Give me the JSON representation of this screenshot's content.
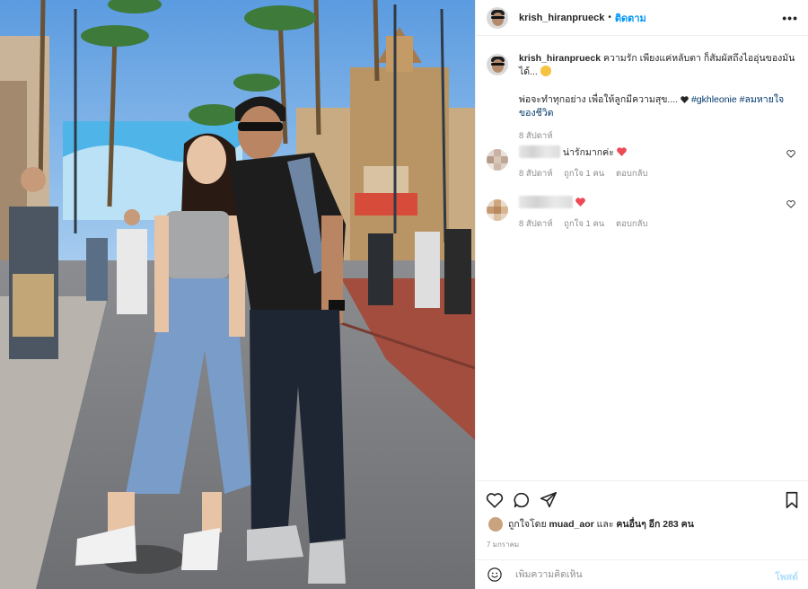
{
  "header": {
    "username": "krish_hiranprueck",
    "separator": "•",
    "follow_label": "ติดตาม",
    "more_icon": "more-horizontal-icon"
  },
  "caption": {
    "username": "krish_hiranprueck",
    "line1": "ความรัก เพียงแค่หลับตา ก็สัมผัสถึงไออุ่นของมันได้...",
    "line2": "พ่อจะทำทุกอย่าง เพื่อให้ลูกมีความสุข....",
    "hashtag1": "#gkhleonie",
    "hashtag2": "#ลมหายใจของชีวิต",
    "time": "8 สัปดาห์"
  },
  "comments": [
    {
      "text": "น่ารักมากค่ะ",
      "time": "8 สัปดาห์",
      "likes": "ถูกใจ 1 คน",
      "reply": "ตอบกลับ"
    },
    {
      "text": "",
      "time": "8 สัปดาห์",
      "likes": "ถูกใจ 1 คน",
      "reply": "ตอบกลับ"
    }
  ],
  "actions": {
    "icons": [
      "heart-icon",
      "comment-icon",
      "share-icon",
      "bookmark-icon"
    ]
  },
  "likes": {
    "prefix": "ถูกใจโดย",
    "user": "muad_aor",
    "middle": "และ",
    "others": "คนอื่นๆ อีก 283 คน"
  },
  "post_date": "7 มกราคม",
  "add_comment": {
    "placeholder": "เพิ่มความคิดเห็น",
    "post_label": "โพสต์"
  },
  "colors": {
    "link_blue": "#0095f6",
    "hashtag_blue": "#00376b",
    "meta_gray": "#8e8e8e",
    "heart_red": "#ed4956",
    "post_disabled": "#b2dffc"
  }
}
